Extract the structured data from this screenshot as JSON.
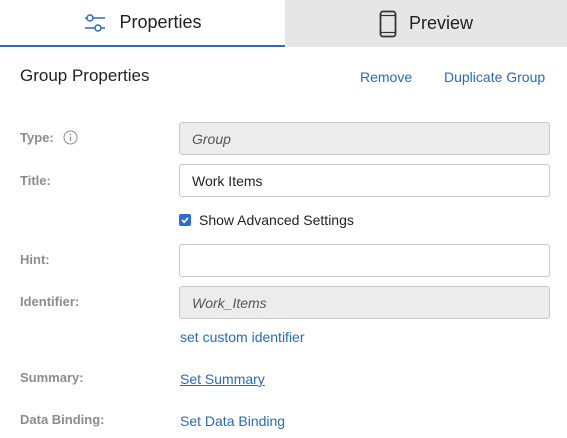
{
  "tabs": {
    "properties": {
      "label": "Properties",
      "icon": "sliders-icon"
    },
    "preview": {
      "label": "Preview",
      "icon": "phone-icon"
    }
  },
  "header": {
    "title": "Group Properties",
    "remove_label": "Remove",
    "duplicate_label": "Duplicate Group"
  },
  "form": {
    "type_label": "Type:",
    "type_value": "Group",
    "title_label": "Title:",
    "title_value": "Work Items",
    "advanced_label": "Show Advanced Settings",
    "advanced_checked": true,
    "hint_label": "Hint:",
    "hint_value": "",
    "identifier_label": "Identifier:",
    "identifier_value": "Work_Items",
    "custom_identifier_link": "set custom identifier",
    "summary_label": "Summary:",
    "summary_link": "Set Summary",
    "binding_label": "Data Binding:",
    "binding_link": "Set Data Binding"
  },
  "colors": {
    "accent": "#2a6bb5",
    "tab_inactive_bg": "#e6e6e6",
    "checkbox": "#2f6dd1"
  }
}
